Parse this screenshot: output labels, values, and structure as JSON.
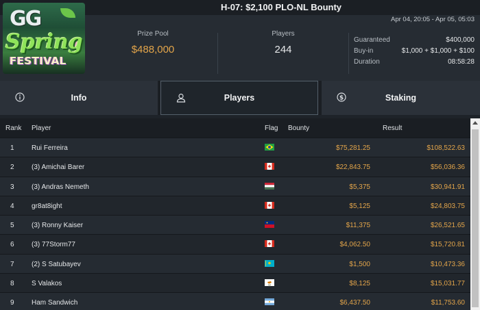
{
  "title": "H-07: $2,100 PLO-NL Bounty",
  "date_range": "Apr 04, 20:05 - Apr 05, 05:03",
  "logo": {
    "line1": "GG",
    "line2": "Spring",
    "line3": "FESTIVAL"
  },
  "stats": {
    "prize_pool_label": "Prize Pool",
    "prize_pool_value": "$488,000",
    "players_label": "Players",
    "players_value": "244"
  },
  "details": {
    "guaranteed_label": "Guaranteed",
    "guaranteed_value": "$400,000",
    "buyin_label": "Buy-in",
    "buyin_value": "$1,000 + $1,000 + $100",
    "duration_label": "Duration",
    "duration_value": "08:58:28"
  },
  "tabs": [
    {
      "label": "Info",
      "icon": "info-icon"
    },
    {
      "label": "Players",
      "icon": "user-icon"
    },
    {
      "label": "Staking",
      "icon": "dollar-coin-icon"
    }
  ],
  "table": {
    "headers": {
      "rank": "Rank",
      "player": "Player",
      "flag": "Flag",
      "bounty": "Bounty",
      "result": "Result"
    },
    "rows": [
      {
        "rank": "1",
        "player": "Rui Ferreira",
        "flag": "brazil",
        "bounty": "$75,281.25",
        "result": "$108,522.63"
      },
      {
        "rank": "2",
        "player": "(3) Amichai Barer",
        "flag": "canada",
        "bounty": "$22,843.75",
        "result": "$56,036.36"
      },
      {
        "rank": "3",
        "player": "(3) Andras Nemeth",
        "flag": "hungary",
        "bounty": "$5,375",
        "result": "$30,941.91"
      },
      {
        "rank": "4",
        "player": "gr8at8ight",
        "flag": "canada",
        "bounty": "$5,125",
        "result": "$24,803.75"
      },
      {
        "rank": "5",
        "player": "(3) Ronny Kaiser",
        "flag": "liechtenstein",
        "bounty": "$11,375",
        "result": "$26,521.65"
      },
      {
        "rank": "6",
        "player": "(3) 77Storm77",
        "flag": "canada",
        "bounty": "$4,062.50",
        "result": "$15,720.81"
      },
      {
        "rank": "7",
        "player": "(2) S Satubayev",
        "flag": "kazakhstan",
        "bounty": "$1,500",
        "result": "$10,473.36"
      },
      {
        "rank": "8",
        "player": "S Valakos",
        "flag": "cyprus",
        "bounty": "$8,125",
        "result": "$15,031.77"
      },
      {
        "rank": "9",
        "player": "Ham Sandwich",
        "flag": "argentina",
        "bounty": "$6,437.50",
        "result": "$11,753.60"
      }
    ]
  },
  "colors": {
    "accent": "#e3a54a",
    "background": "#1e2329",
    "panel": "#262c33"
  }
}
